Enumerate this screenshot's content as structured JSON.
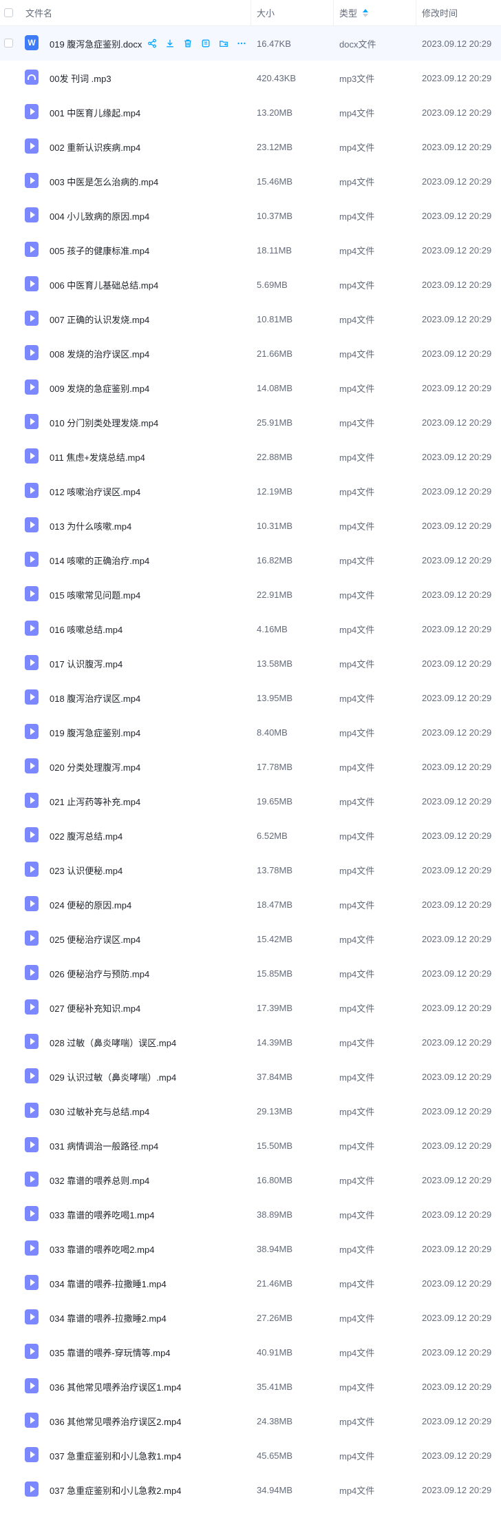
{
  "header": {
    "name": "文件名",
    "size": "大小",
    "type": "类型",
    "time": "修改时间"
  },
  "colors": {
    "accent": "#06a7ff",
    "video_icon": "#7b88ff",
    "docx_icon": "#3d7bf7",
    "hover_row": "#f5f8ff"
  },
  "hover_actions": [
    "share-icon",
    "download-icon",
    "delete-icon",
    "rename-icon",
    "move-icon",
    "more-icon"
  ],
  "files": [
    {
      "name": "019 腹泻急症鉴别.docx",
      "size": "16.47KB",
      "type": "docx文件",
      "time": "2023.09.12 20:29",
      "icon": "docx",
      "icon_label": "W"
    },
    {
      "name": "00发 刊词 .mp3",
      "size": "420.43KB",
      "type": "mp3文件",
      "time": "2023.09.12 20:29",
      "icon": "audio"
    },
    {
      "name": "001 中医育儿缘起.mp4",
      "size": "13.20MB",
      "type": "mp4文件",
      "time": "2023.09.12 20:29",
      "icon": "video"
    },
    {
      "name": "002 重新认识疾病.mp4",
      "size": "23.12MB",
      "type": "mp4文件",
      "time": "2023.09.12 20:29",
      "icon": "video"
    },
    {
      "name": "003 中医是怎么治病的.mp4",
      "size": "15.46MB",
      "type": "mp4文件",
      "time": "2023.09.12 20:29",
      "icon": "video"
    },
    {
      "name": "004 小儿致病的原因.mp4",
      "size": "10.37MB",
      "type": "mp4文件",
      "time": "2023.09.12 20:29",
      "icon": "video"
    },
    {
      "name": "005 孩子的健康标准.mp4",
      "size": "18.11MB",
      "type": "mp4文件",
      "time": "2023.09.12 20:29",
      "icon": "video"
    },
    {
      "name": "006 中医育儿基础总结.mp4",
      "size": "5.69MB",
      "type": "mp4文件",
      "time": "2023.09.12 20:29",
      "icon": "video"
    },
    {
      "name": "007 正确的认识发烧.mp4",
      "size": "10.81MB",
      "type": "mp4文件",
      "time": "2023.09.12 20:29",
      "icon": "video"
    },
    {
      "name": "008 发烧的治疗误区.mp4",
      "size": "21.66MB",
      "type": "mp4文件",
      "time": "2023.09.12 20:29",
      "icon": "video"
    },
    {
      "name": "009 发烧的急症鉴别.mp4",
      "size": "14.08MB",
      "type": "mp4文件",
      "time": "2023.09.12 20:29",
      "icon": "video"
    },
    {
      "name": "010 分门别类处理发烧.mp4",
      "size": "25.91MB",
      "type": "mp4文件",
      "time": "2023.09.12 20:29",
      "icon": "video"
    },
    {
      "name": "011 焦虑+发烧总结.mp4",
      "size": "22.88MB",
      "type": "mp4文件",
      "time": "2023.09.12 20:29",
      "icon": "video"
    },
    {
      "name": "012 咳嗽治疗误区.mp4",
      "size": "12.19MB",
      "type": "mp4文件",
      "time": "2023.09.12 20:29",
      "icon": "video"
    },
    {
      "name": "013 为什么咳嗽.mp4",
      "size": "10.31MB",
      "type": "mp4文件",
      "time": "2023.09.12 20:29",
      "icon": "video"
    },
    {
      "name": "014 咳嗽的正确治疗.mp4",
      "size": "16.82MB",
      "type": "mp4文件",
      "time": "2023.09.12 20:29",
      "icon": "video"
    },
    {
      "name": "015 咳嗽常见问题.mp4",
      "size": "22.91MB",
      "type": "mp4文件",
      "time": "2023.09.12 20:29",
      "icon": "video"
    },
    {
      "name": "016 咳嗽总结.mp4",
      "size": "4.16MB",
      "type": "mp4文件",
      "time": "2023.09.12 20:29",
      "icon": "video"
    },
    {
      "name": "017 认识腹泻.mp4",
      "size": "13.58MB",
      "type": "mp4文件",
      "time": "2023.09.12 20:29",
      "icon": "video"
    },
    {
      "name": "018 腹泻治疗误区.mp4",
      "size": "13.95MB",
      "type": "mp4文件",
      "time": "2023.09.12 20:29",
      "icon": "video"
    },
    {
      "name": "019 腹泻急症鉴别.mp4",
      "size": "8.40MB",
      "type": "mp4文件",
      "time": "2023.09.12 20:29",
      "icon": "video"
    },
    {
      "name": "020 分类处理腹泻.mp4",
      "size": "17.78MB",
      "type": "mp4文件",
      "time": "2023.09.12 20:29",
      "icon": "video"
    },
    {
      "name": "021 止泻药等补充.mp4",
      "size": "19.65MB",
      "type": "mp4文件",
      "time": "2023.09.12 20:29",
      "icon": "video"
    },
    {
      "name": "022 腹泻总结.mp4",
      "size": "6.52MB",
      "type": "mp4文件",
      "time": "2023.09.12 20:29",
      "icon": "video"
    },
    {
      "name": "023 认识便秘.mp4",
      "size": "13.78MB",
      "type": "mp4文件",
      "time": "2023.09.12 20:29",
      "icon": "video"
    },
    {
      "name": "024 便秘的原因.mp4",
      "size": "18.47MB",
      "type": "mp4文件",
      "time": "2023.09.12 20:29",
      "icon": "video"
    },
    {
      "name": "025 便秘治疗误区.mp4",
      "size": "15.42MB",
      "type": "mp4文件",
      "time": "2023.09.12 20:29",
      "icon": "video"
    },
    {
      "name": "026 便秘治疗与预防.mp4",
      "size": "15.85MB",
      "type": "mp4文件",
      "time": "2023.09.12 20:29",
      "icon": "video"
    },
    {
      "name": "027 便秘补充知识.mp4",
      "size": "17.39MB",
      "type": "mp4文件",
      "time": "2023.09.12 20:29",
      "icon": "video"
    },
    {
      "name": "028 过敏（鼻炎哮喘）误区.mp4",
      "size": "14.39MB",
      "type": "mp4文件",
      "time": "2023.09.12 20:29",
      "icon": "video"
    },
    {
      "name": "029 认识过敏（鼻炎哮喘）.mp4",
      "size": "37.84MB",
      "type": "mp4文件",
      "time": "2023.09.12 20:29",
      "icon": "video"
    },
    {
      "name": "030 过敏补充与总结.mp4",
      "size": "29.13MB",
      "type": "mp4文件",
      "time": "2023.09.12 20:29",
      "icon": "video"
    },
    {
      "name": "031 病情调治一般路径.mp4",
      "size": "15.50MB",
      "type": "mp4文件",
      "time": "2023.09.12 20:29",
      "icon": "video"
    },
    {
      "name": "032 靠谱的喂养总则.mp4",
      "size": "16.80MB",
      "type": "mp4文件",
      "time": "2023.09.12 20:29",
      "icon": "video"
    },
    {
      "name": "033 靠谱的喂养吃喝1.mp4",
      "size": "38.89MB",
      "type": "mp4文件",
      "time": "2023.09.12 20:29",
      "icon": "video"
    },
    {
      "name": "033 靠谱的喂养吃喝2.mp4",
      "size": "38.94MB",
      "type": "mp4文件",
      "time": "2023.09.12 20:29",
      "icon": "video"
    },
    {
      "name": "034 靠谱的喂养-拉撒睡1.mp4",
      "size": "21.46MB",
      "type": "mp4文件",
      "time": "2023.09.12 20:29",
      "icon": "video"
    },
    {
      "name": "034 靠谱的喂养-拉撒睡2.mp4",
      "size": "27.26MB",
      "type": "mp4文件",
      "time": "2023.09.12 20:29",
      "icon": "video"
    },
    {
      "name": "035 靠谱的喂养-穿玩情等.mp4",
      "size": "40.91MB",
      "type": "mp4文件",
      "time": "2023.09.12 20:29",
      "icon": "video"
    },
    {
      "name": "036 其他常见喂养治疗误区1.mp4",
      "size": "35.41MB",
      "type": "mp4文件",
      "time": "2023.09.12 20:29",
      "icon": "video"
    },
    {
      "name": "036 其他常见喂养治疗误区2.mp4",
      "size": "24.38MB",
      "type": "mp4文件",
      "time": "2023.09.12 20:29",
      "icon": "video"
    },
    {
      "name": "037 急重症鉴别和小儿急救1.mp4",
      "size": "45.65MB",
      "type": "mp4文件",
      "time": "2023.09.12 20:29",
      "icon": "video"
    },
    {
      "name": "037 急重症鉴别和小儿急救2.mp4",
      "size": "34.94MB",
      "type": "mp4文件",
      "time": "2023.09.12 20:29",
      "icon": "video"
    }
  ]
}
